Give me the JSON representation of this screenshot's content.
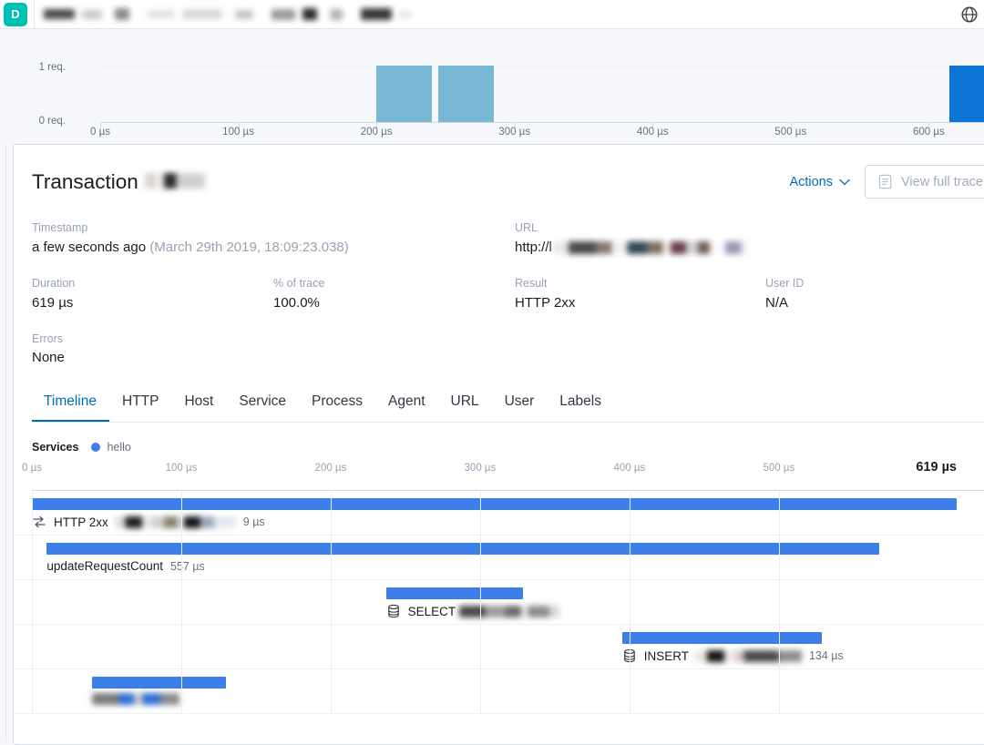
{
  "topnav": {
    "logo_letter": "D",
    "logo_color": "#00bfb3",
    "globe_icon": "globe-icon",
    "blurred_items": [
      {
        "w": 34,
        "h": 11,
        "c": "#4a4a4a"
      },
      {
        "w": 22,
        "h": 10,
        "c": "#c9c9c9"
      },
      {
        "w": 16,
        "h": 13,
        "c": "#8a8a8a"
      },
      {
        "w": 30,
        "h": 9,
        "c": "#e2e2e2"
      },
      {
        "w": 44,
        "h": 11,
        "c": "#d8d8d8"
      },
      {
        "w": 20,
        "h": 10,
        "c": "#c4c4c4"
      },
      {
        "w": 26,
        "h": 12,
        "c": "#9a9a9a"
      },
      {
        "w": 16,
        "h": 13,
        "c": "#2a2a2a"
      },
      {
        "w": 14,
        "h": 12,
        "c": "#b4b4b4"
      },
      {
        "w": 34,
        "h": 13,
        "c": "#383838"
      },
      {
        "w": 14,
        "h": 8,
        "c": "#e4e4e4"
      }
    ]
  },
  "histogram": {
    "y_labels": [
      "1 req.",
      "0 req."
    ],
    "x_ticks": [
      "0 µs",
      "100 µs",
      "200 µs",
      "300 µs",
      "400 µs",
      "500 µs",
      "600 µs"
    ],
    "bar_color": "#79b8d4",
    "selected_bar_color": "#0b74d4"
  },
  "chart_data": {
    "type": "bar",
    "title": "",
    "xlabel": "",
    "ylabel": "requests",
    "categories": [
      "0 µs",
      "100 µs",
      "200 µs",
      "300 µs",
      "400 µs",
      "500 µs",
      "600 µs"
    ],
    "bins": [
      {
        "x_start": 200,
        "x_end": 240,
        "value": 1,
        "selected": false
      },
      {
        "x_start": 245,
        "x_end": 285,
        "value": 1,
        "selected": false
      },
      {
        "x_start": 615,
        "x_end": 640,
        "value": 1,
        "selected": true
      }
    ],
    "xlim": [
      0,
      640
    ],
    "ylim": [
      0,
      1
    ],
    "grid": false,
    "legend": "none"
  },
  "transaction": {
    "title_prefix": "Transaction",
    "title_redacted": true,
    "actions_label": "Actions",
    "actions_icon": "chevron-down-icon",
    "view_trace_label": "View full trace",
    "view_trace_icon": "document-icon",
    "view_trace_disabled": true
  },
  "meta": {
    "timestamp": {
      "label": "Timestamp",
      "relative": "a few seconds ago",
      "absolute": "(March 29th 2019, 18:09:23.038)"
    },
    "url": {
      "label": "URL",
      "value_prefix": "http://l",
      "redacted": true
    },
    "duration": {
      "label": "Duration",
      "value": "619 µs"
    },
    "pct_of_trace": {
      "label": "% of trace",
      "value": "100.0%"
    },
    "result": {
      "label": "Result",
      "value": "HTTP 2xx"
    },
    "user_id": {
      "label": "User ID",
      "value": "N/A"
    },
    "errors": {
      "label": "Errors",
      "value": "None"
    }
  },
  "tabs": [
    {
      "label": "Timeline",
      "active": true
    },
    {
      "label": "HTTP",
      "active": false
    },
    {
      "label": "Host",
      "active": false
    },
    {
      "label": "Service",
      "active": false
    },
    {
      "label": "Process",
      "active": false
    },
    {
      "label": "Agent",
      "active": false
    },
    {
      "label": "URL",
      "active": false
    },
    {
      "label": "User",
      "active": false
    },
    {
      "label": "Labels",
      "active": false
    }
  ],
  "timeline": {
    "services_label": "Services",
    "legend_service": "hello",
    "legend_color": "#3d7fe8",
    "ticks": [
      "0 µs",
      "100 µs",
      "200 µs",
      "300 µs",
      "400 µs",
      "500 µs"
    ],
    "end_tick": "619 µs",
    "total_us": 619,
    "bar_color": "#3d7fe8",
    "rows": [
      {
        "name": "HTTP 2xx",
        "icon": "transaction-icon",
        "start_us": 0,
        "duration_us": 619,
        "duration_label": "9 µs",
        "redacted_after_name": true,
        "indent": 0
      },
      {
        "name": "updateRequestCount",
        "icon": "none",
        "start_us": 10,
        "duration_us": 557,
        "duration_label": "557 µs",
        "redacted_after_name": false,
        "indent": 1
      },
      {
        "name": "SELECT",
        "icon": "database-icon",
        "start_us": 237,
        "duration_us": 92,
        "duration_label": "",
        "redacted_after_name": true,
        "indent": 2
      },
      {
        "name": "INSERT",
        "icon": "database-icon",
        "start_us": 395,
        "duration_us": 134,
        "duration_label": "134 µs",
        "redacted_after_name": true,
        "indent": 2
      },
      {
        "name": "",
        "icon": "none",
        "start_us": 40,
        "duration_us": 90,
        "duration_label": "",
        "redacted_after_name": true,
        "indent": 2
      }
    ]
  }
}
